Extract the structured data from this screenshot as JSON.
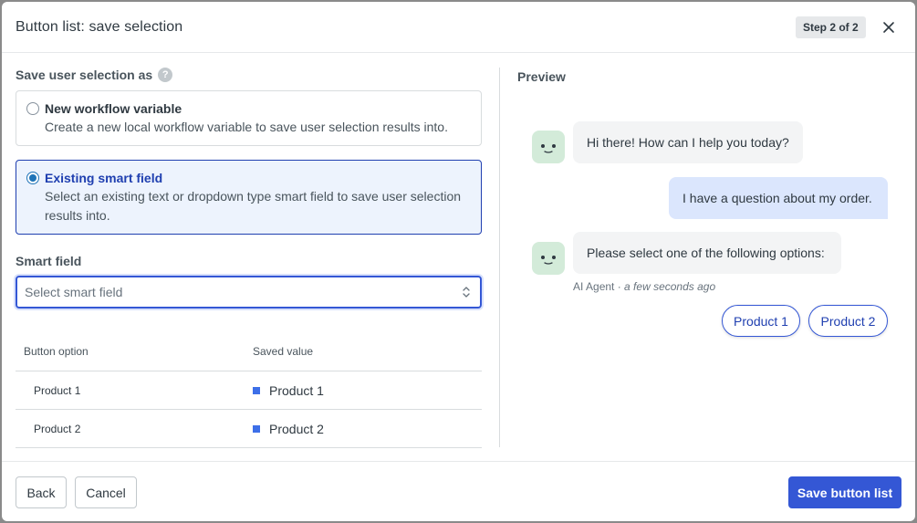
{
  "header": {
    "title": "Button list: save selection",
    "step": "Step 2 of 2"
  },
  "save_as": {
    "label": "Save user selection as",
    "help": "?",
    "options": [
      {
        "title": "New workflow variable",
        "desc": "Create a new local workflow variable to save user selection results into.",
        "selected": false
      },
      {
        "title": "Existing smart field",
        "desc": "Select an existing text or dropdown type smart field to save user selection results into.",
        "selected": true
      }
    ]
  },
  "smart_field": {
    "label": "Smart field",
    "placeholder": "Select smart field"
  },
  "mapping_table": {
    "headers": [
      "Button option",
      "Saved value"
    ],
    "rows": [
      {
        "option": "Product 1",
        "value": "Product 1"
      },
      {
        "option": "Product 2",
        "value": "Product 2"
      }
    ]
  },
  "preview": {
    "label": "Preview",
    "messages": [
      {
        "from": "agent",
        "text": "Hi there! How can I help you today?"
      },
      {
        "from": "user",
        "text": "I have a question about my order."
      },
      {
        "from": "agent",
        "text": "Please select one of the following options:"
      }
    ],
    "meta_sender": "AI Agent · ",
    "meta_time": "a few seconds ago",
    "buttons": [
      "Product 1",
      "Product 2"
    ]
  },
  "footer": {
    "back": "Back",
    "cancel": "Cancel",
    "save": "Save button list"
  },
  "colors": {
    "primary": "#3457d5",
    "selected_bg": "#edf3fd",
    "user_bubble": "#dbe6fd",
    "avatar_bg": "#d3ebd9"
  }
}
